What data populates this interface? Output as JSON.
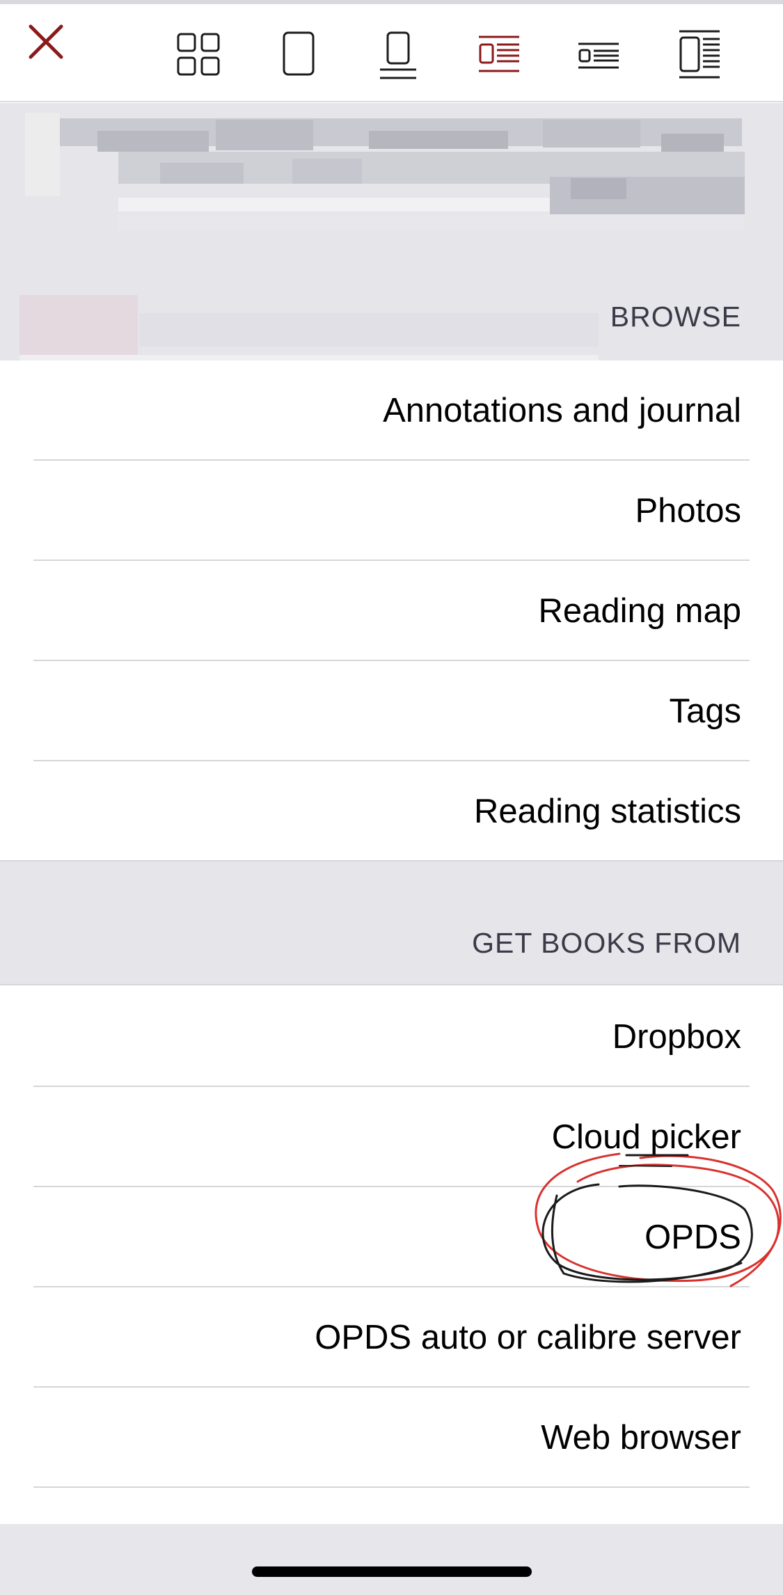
{
  "toolbar": {
    "close_icon": "close-x-icon",
    "accent_color": "#8b1a1a",
    "views": [
      {
        "name": "grid-view-icon",
        "selected": false
      },
      {
        "name": "single-page-view-icon",
        "selected": false
      },
      {
        "name": "page-with-lines-view-icon",
        "selected": false
      },
      {
        "name": "list-with-thumbnail-view-icon",
        "selected": true
      },
      {
        "name": "compact-list-view-icon",
        "selected": false
      },
      {
        "name": "detail-list-view-icon",
        "selected": false
      }
    ]
  },
  "browse": {
    "header": "BROWSE",
    "items": [
      {
        "label": "Annotations and journal"
      },
      {
        "label": "Photos"
      },
      {
        "label": "Reading map"
      },
      {
        "label": "Tags"
      },
      {
        "label": "Reading statistics"
      }
    ]
  },
  "get_books": {
    "header": "GET BOOKS FROM",
    "items": [
      {
        "label": "Dropbox"
      },
      {
        "label": "Cloud picker"
      },
      {
        "label": "OPDS"
      },
      {
        "label": "OPDS auto or calibre server"
      },
      {
        "label": "Web browser"
      }
    ]
  },
  "annotation": {
    "circled_item": "OPDS",
    "colors": [
      "#d8322e",
      "#1a1a1a"
    ]
  }
}
